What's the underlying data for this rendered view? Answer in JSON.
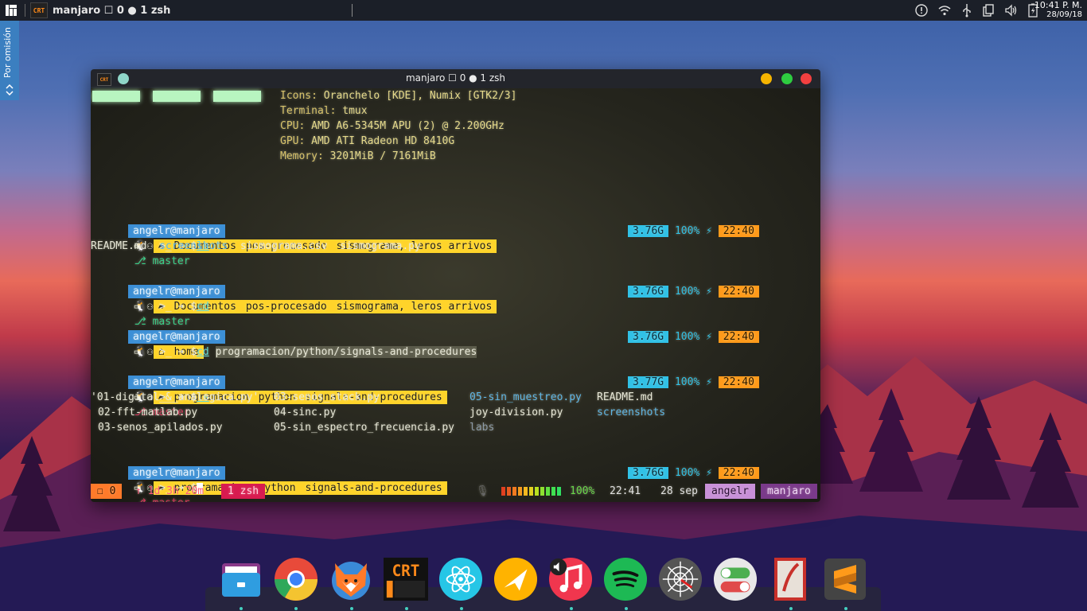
{
  "topbar": {
    "task_title": "manjaro ☐ 0 ● 1 zsh",
    "clock_time": "10:41 P. M.",
    "clock_date": "28/09/18"
  },
  "side_tab": {
    "label": "Por omisión"
  },
  "window": {
    "title": "manjaro ☐ 0 ● 1 zsh",
    "app_icon_text": "CRT",
    "buttons": {
      "minimize_color": "#f5b400",
      "maximize_color": "#2ecc40",
      "close_color": "#f24040"
    }
  },
  "terminal": {
    "sysinfo": [
      {
        "key": "Icons:",
        "value": "Oranchelo [KDE], Numix [GTK2/3]"
      },
      {
        "key": "Terminal:",
        "value": "tmux"
      },
      {
        "key": "CPU:",
        "value": "AMD A6-5345M APU (2) @ 2.200GHz"
      },
      {
        "key": "GPU:",
        "value": "AMD ATI Radeon HD 8410G"
      },
      {
        "key": "Memory:",
        "value": "3201MiB / 7161MiB"
      }
    ],
    "prompt_user": "angelr@manjaro",
    "dollar": "$",
    "prompt1": {
      "dirs": [
        "Documentos",
        "pos-procesado",
        "sismograma, leros arrivos"
      ],
      "git": "master",
      "cmd": "ls",
      "mem": "3.76G",
      "bat": "100%",
      "time": "22:40"
    },
    "output1": [
      "README.md",
      "screenshots",
      "sismograma.csv",
      "sismograma.py"
    ],
    "prompt2": {
      "dirs": [
        "Documentos",
        "pos-procesado",
        "sismograma, leros arrivos"
      ],
      "git": "master",
      "cmd": "cd",
      "mem": "3.76G",
      "bat": "100%",
      "time": "22:40"
    },
    "prompt3": {
      "dirs": [
        "home"
      ],
      "cmd": "cd",
      "arg": "programacion/python/signals-and-procedures",
      "mem": "3.76G",
      "bat": "100%",
      "time": "22:40"
    },
    "prompt4": {
      "dirs": [
        "programacion",
        "python",
        "signals-and-procedures"
      ],
      "git": "master",
      "cmd": "ls",
      "mem": "3.77G",
      "bat": "100%",
      "time": "22:40"
    },
    "listing": [
      [
        "'01-digital_&_analogica.py'",
        "03-senos_stack.py",
        "05-sin_muestreo.py",
        "README.md"
      ],
      [
        "02-fft-matlab.py",
        "04-sinc.py",
        "joy-division.py",
        "screenshots"
      ],
      [
        "03-senos_apilados.py",
        "05-sin_espectro_frecuencia.py",
        "labs",
        ""
      ]
    ],
    "prompt5": {
      "dirs": [
        "programacion",
        "python",
        "signals-and-procedures"
      ],
      "git": "master",
      "mem": "3.76G",
      "bat": "100%",
      "time": "22:40"
    },
    "status": {
      "session": "☐ 0",
      "uptime": "↑ 1d 3h 20m",
      "window": "1 zsh",
      "battery": "100%",
      "time": "22:41",
      "date": "28 sep",
      "user": "angelr",
      "host": "manjaro"
    }
  },
  "dock": {
    "items": [
      {
        "name": "files",
        "color": "#2f9de0"
      },
      {
        "name": "chromium",
        "color": "#e84a3a"
      },
      {
        "name": "firefox",
        "color": "#ff7a2a"
      },
      {
        "name": "cool-retro-term",
        "label": "CRT",
        "color": "#ff8a1a"
      },
      {
        "name": "atom",
        "color": "#26c6e6"
      },
      {
        "name": "feedreader",
        "color": "#ffb300"
      },
      {
        "name": "music",
        "color": "#f0364e"
      },
      {
        "name": "spotify",
        "color": "#1db954"
      },
      {
        "name": "web-spider",
        "color": "#555555"
      },
      {
        "name": "toggles",
        "color": "#e0e0e0"
      },
      {
        "name": "pdf-viewer",
        "color": "#c8302a"
      },
      {
        "name": "sublime-text",
        "color": "#ff9a1a"
      }
    ]
  }
}
